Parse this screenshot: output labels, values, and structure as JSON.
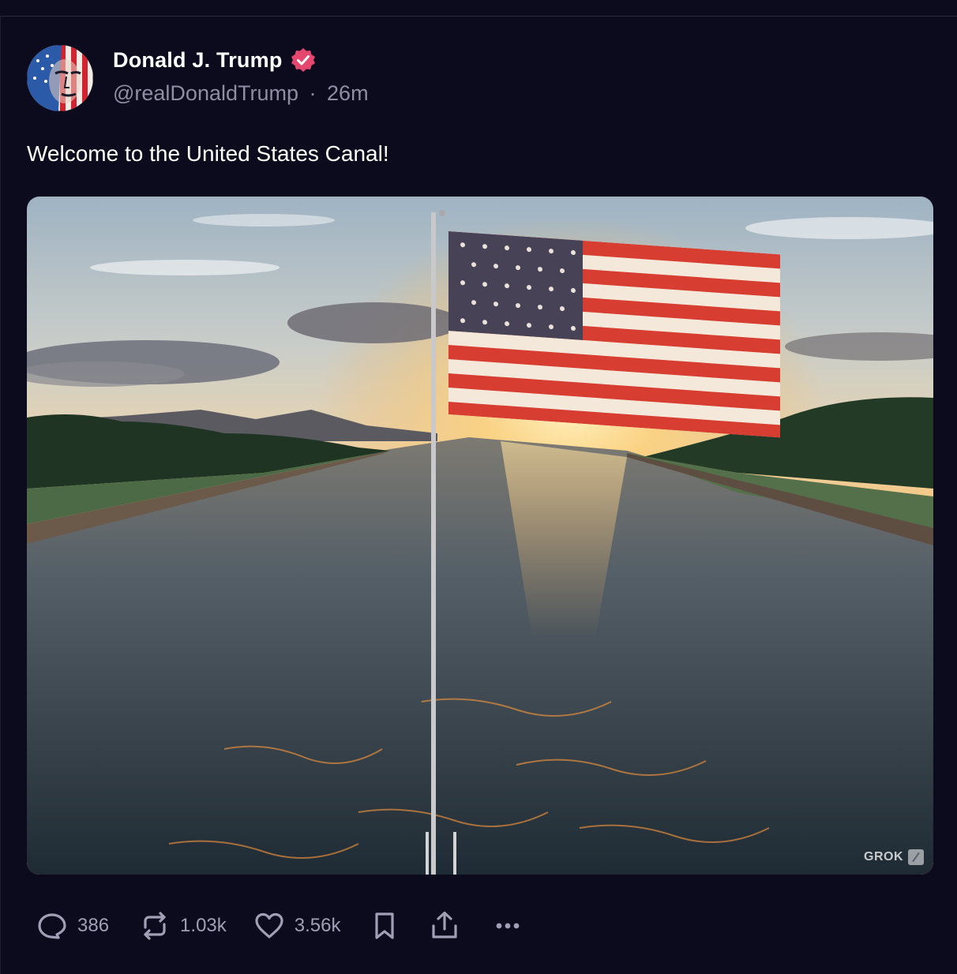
{
  "post": {
    "author_name": "Donald J. Trump",
    "handle": "@realDonaldTrump",
    "separator": "·",
    "time_ago": "26m",
    "text": "Welcome to the United States Canal!",
    "media_watermark": "GROK"
  },
  "actions": {
    "replies": "386",
    "reposts": "1.03k",
    "likes": "3.56k"
  },
  "colors": {
    "background": "#0c0b1d",
    "verified_badge": "#e6476f",
    "muted_text": "#8e8da3",
    "action_icon": "#a09fb5"
  },
  "icons": [
    "verified-badge-icon",
    "reply-icon",
    "repost-icon",
    "like-icon",
    "bookmark-icon",
    "share-icon",
    "more-icon"
  ]
}
